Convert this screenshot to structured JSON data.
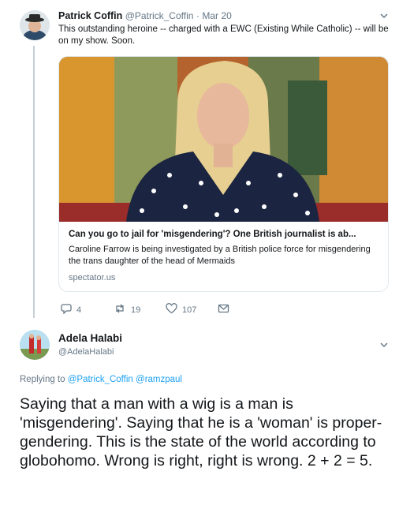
{
  "tweet1": {
    "display_name": "Patrick Coffin",
    "handle": "@Patrick_Coffin",
    "separator": "·",
    "time": "Mar 20",
    "text": "This outstanding heroine -- charged with a EWC (Existing While Catholic) -- will be on my show. Soon.",
    "card": {
      "title": "Can you go to jail for 'misgendering'? One British journalist is ab...",
      "description": "Caroline Farrow is being investigated by a British police force for misgendering the trans daughter of the head of Mermaids",
      "domain": "spectator.us"
    },
    "actions": {
      "replies": "4",
      "retweets": "19",
      "likes": "107"
    }
  },
  "tweet2": {
    "display_name": "Adela Halabi",
    "handle": "@AdelaHalabi",
    "reply_prefix": "Replying to",
    "reply_to_1": "@Patrick_Coffin",
    "reply_to_2": "@ramzpaul",
    "text": "Saying that a man with a wig is a man is 'misgendering'. Saying that he  is a 'woman' is proper-gendering. This is the state of the world  according to globohomo. Wrong is right, right is wrong. 2 + 2 = 5."
  },
  "colors": {
    "link": "#1da1f2",
    "muted": "#657786",
    "thread_line": "#c4cfd6",
    "card_border": "#e1e8ed"
  },
  "icons": [
    "reply-icon",
    "retweet-icon",
    "like-icon",
    "dm-icon",
    "chevron-down-icon"
  ]
}
